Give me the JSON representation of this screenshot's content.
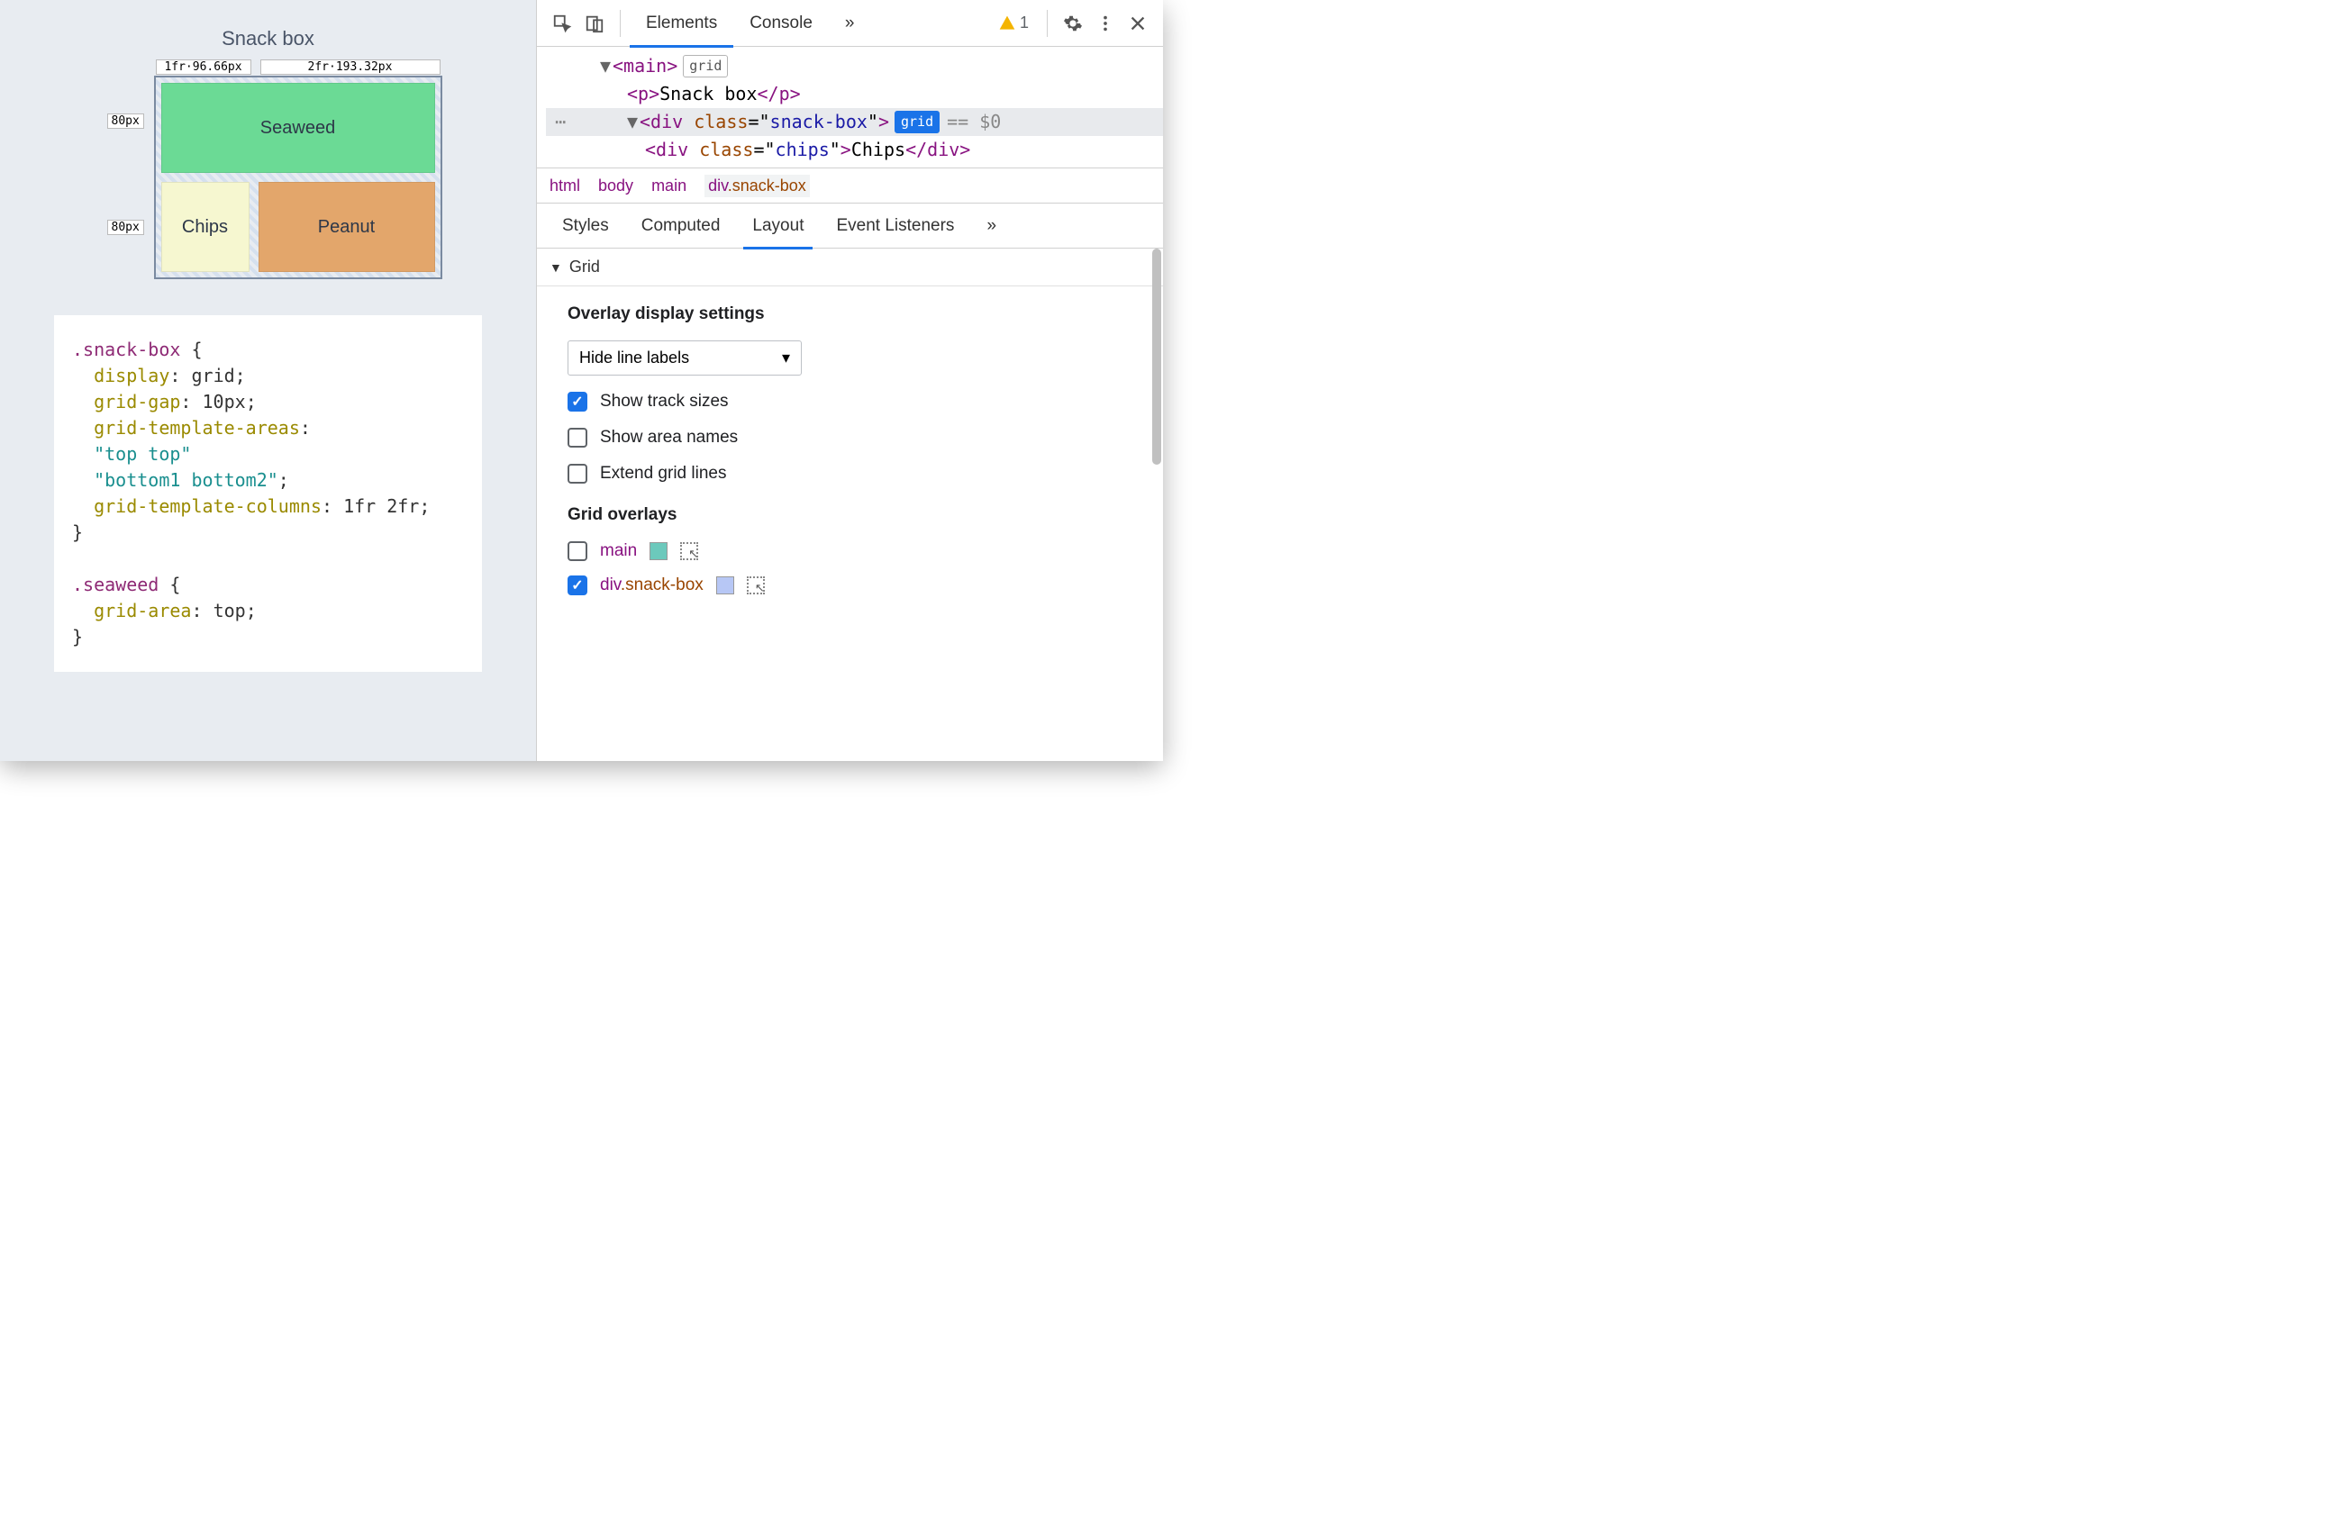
{
  "page": {
    "title": "Snack box",
    "grid_cells": {
      "seaweed": "Seaweed",
      "chips": "Chips",
      "peanut": "Peanut"
    },
    "col_labels": [
      "1fr·96.66px",
      "2fr·193.32px"
    ],
    "row_labels": [
      "80px",
      "80px"
    ]
  },
  "css_source": ".snack-box {\n  display: grid;\n  grid-gap: 10px;\n  grid-template-areas:\n  \"top top\"\n  \"bottom1 bottom2\";\n  grid-template-columns: 1fr 2fr;\n}\n\n.seaweed {\n  grid-area: top;\n}",
  "devtools": {
    "tabs": {
      "elements": "Elements",
      "console": "Console",
      "more": "»"
    },
    "warning_count": "1",
    "dom": {
      "main_tag": "main",
      "main_badge": "grid",
      "p_text": "Snack box",
      "div_tag": "div",
      "div_class": "snack-box",
      "div_badge": "grid",
      "div_eq": "== $0",
      "chips_class": "chips",
      "chips_text": "Chips"
    },
    "breadcrumb": [
      "html",
      "body",
      "main",
      "div.snack-box"
    ],
    "sub_tabs": {
      "styles": "Styles",
      "computed": "Computed",
      "layout": "Layout",
      "event": "Event Listeners",
      "more": "»"
    },
    "layout": {
      "grid_section": "Grid",
      "overlay_heading": "Overlay display settings",
      "select_value": "Hide line labels",
      "checks": {
        "track_sizes": {
          "label": "Show track sizes",
          "checked": true
        },
        "area_names": {
          "label": "Show area names",
          "checked": false
        },
        "extend_lines": {
          "label": "Extend grid lines",
          "checked": false
        }
      },
      "overlays_heading": "Grid overlays",
      "overlays": {
        "main": {
          "name": "main",
          "checked": false,
          "color": "teal"
        },
        "snack": {
          "name": "div",
          "cls": ".snack-box",
          "checked": true,
          "color": "blue"
        }
      }
    }
  }
}
